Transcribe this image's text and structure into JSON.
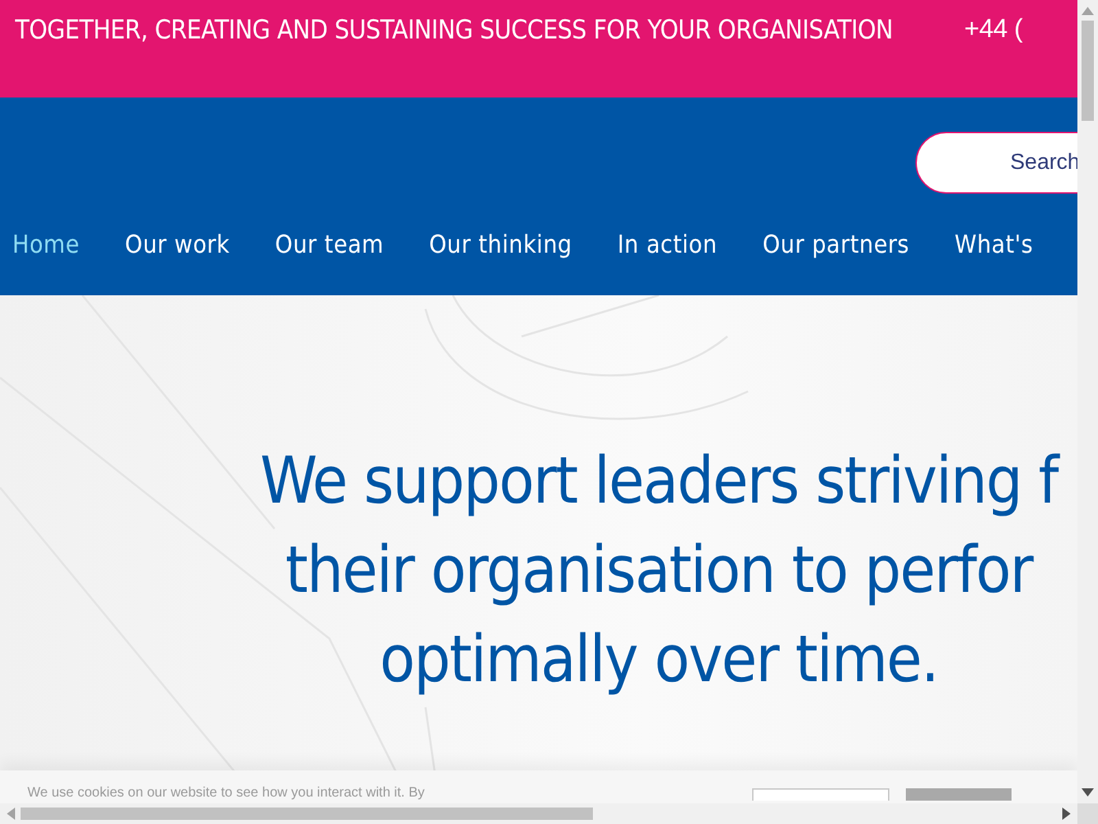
{
  "top_bar": {
    "tagline": "TOGETHER, CREATING AND SUSTAINING SUCCESS FOR YOUR ORGANISATION",
    "phone": "+44 ("
  },
  "search": {
    "placeholder": "Search"
  },
  "nav": [
    {
      "label": "Home",
      "selected": true
    },
    {
      "label": "Our work",
      "selected": false
    },
    {
      "label": "Our team",
      "selected": false
    },
    {
      "label": "Our thinking",
      "selected": false
    },
    {
      "label": "In action",
      "selected": false
    },
    {
      "label": "Our partners",
      "selected": false
    },
    {
      "label": "What's",
      "selected": false
    }
  ],
  "hero": {
    "lines": [
      "We support leaders striving f",
      "their organisation to perfor",
      "optimally over time."
    ]
  },
  "cookie_bar": {
    "text": "We use cookies on our website to see how you interact with it. By"
  }
}
